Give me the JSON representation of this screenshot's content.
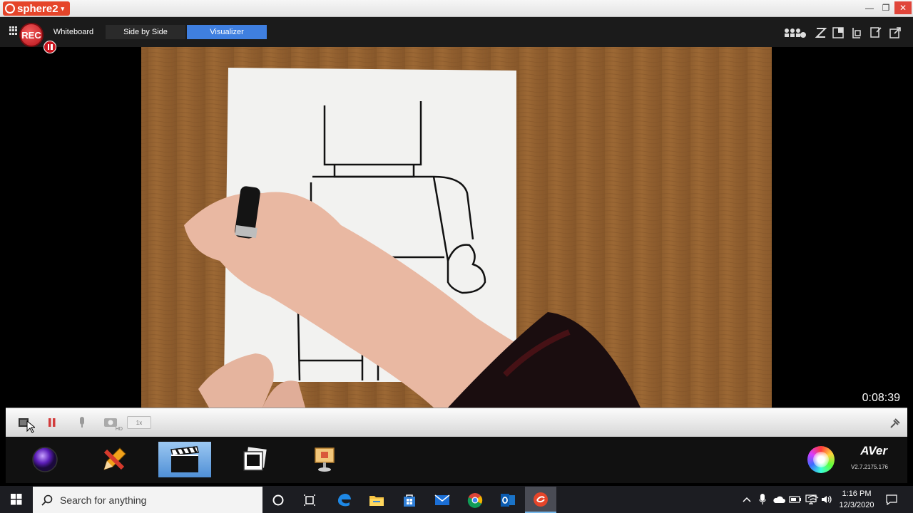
{
  "app": {
    "logo_text": "sphere2",
    "window_controls": [
      "minimize-icon",
      "restore-icon",
      "close-icon"
    ]
  },
  "modebar": {
    "rec_label": "REC",
    "tabs": [
      {
        "label": "Whiteboard",
        "active": false
      },
      {
        "label": "Side by Side",
        "active": false
      },
      {
        "label": "Visualizer",
        "active": true
      }
    ],
    "right_icons": [
      "people-network-icon",
      "zoom-icon",
      "split-screen-icon",
      "window-icon",
      "freeze-icon",
      "external-icon"
    ]
  },
  "stage": {
    "timer": "0:08:39",
    "content": "live camera feed"
  },
  "strip": {
    "icons": [
      "stop-icon",
      "pause-icon",
      "mic-icon",
      "camera-hd-icon",
      "speed-icon",
      "pin-icon"
    ],
    "speed_label": "1x",
    "hd_label": "HD"
  },
  "dock": {
    "items": [
      "camera-icon",
      "annotation-pencil-icon",
      "clapperboard-icon",
      "snapshot-gallery-icon",
      "presenter-icon"
    ],
    "active_index": 2,
    "brand": "AVer",
    "version": "V2.7.2175.176"
  },
  "taskbar": {
    "search_placeholder": "Search for anything",
    "apps": [
      "cortana-icon",
      "task-view-icon",
      "edge-icon",
      "file-explorer-icon",
      "store-icon",
      "mail-icon",
      "chrome-icon",
      "outlook-icon",
      "sphere2-icon"
    ],
    "tray": [
      "chevron-up-icon",
      "mic-icon",
      "cloud-icon",
      "battery-icon",
      "monitor-icon",
      "wifi-icon",
      "volume-icon"
    ],
    "time": "1:16 PM",
    "date": "12/3/2020"
  },
  "colors": {
    "accent_tab": "#3f7fe0",
    "rec_red": "#c9141d",
    "brand_orange": "#e5452a"
  }
}
